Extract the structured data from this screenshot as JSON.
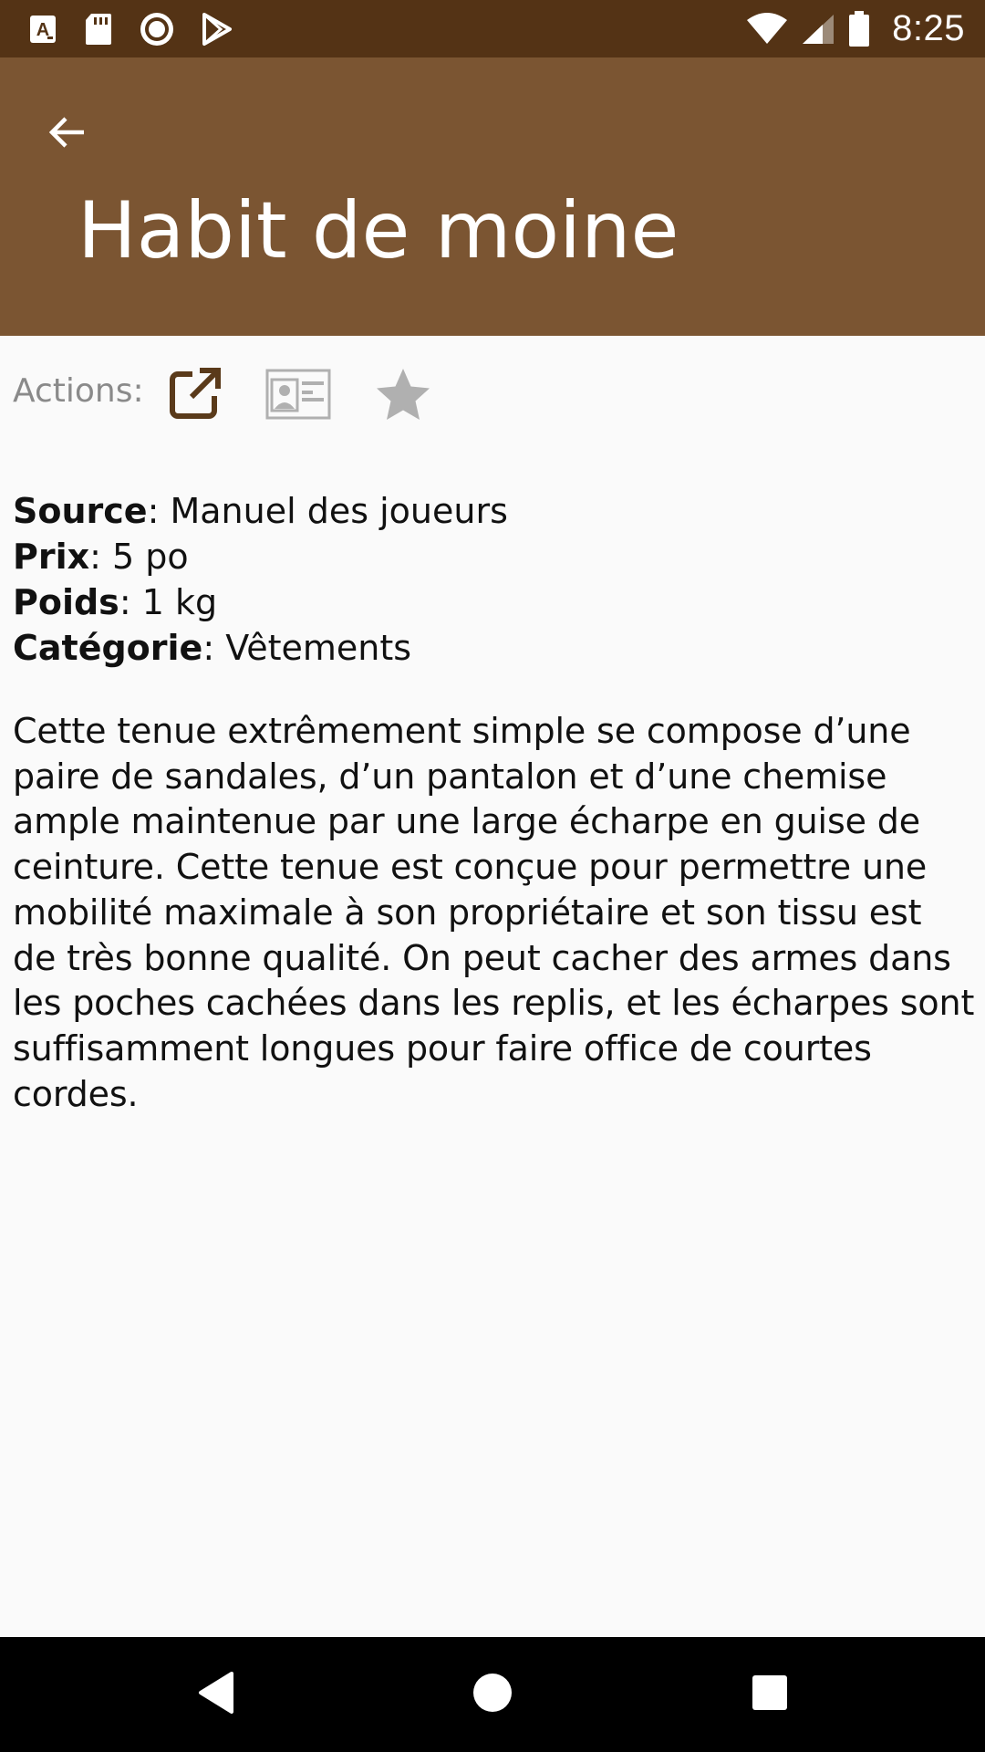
{
  "status_bar": {
    "time": "8:25",
    "icons": [
      "a-notification-icon",
      "sd-card-icon",
      "record-icon",
      "play-store-icon",
      "wifi-icon",
      "cell-signal-icon",
      "battery-icon"
    ]
  },
  "app_bar": {
    "back_icon": "arrow-back-icon",
    "title": "Habit de moine",
    "background": "#7B5532"
  },
  "actions": {
    "label": "Actions:",
    "buttons": [
      {
        "name": "open-external",
        "icon": "open-in-new-icon",
        "color": "#5A3A1A"
      },
      {
        "name": "character-sheet",
        "icon": "id-card-icon",
        "color": "#B0B0B0"
      },
      {
        "name": "favorite",
        "icon": "star-icon",
        "color": "#B0B0B0"
      }
    ]
  },
  "details": {
    "source": {
      "key": "Source",
      "value": ": Manuel des joueurs"
    },
    "price": {
      "key": "Prix",
      "value": ": 5 po"
    },
    "weight": {
      "key": "Poids",
      "value": ": 1 kg"
    },
    "category": {
      "key": "Catégorie",
      "value": ": Vêtements"
    }
  },
  "description": "Cette tenue extrêmement simple se compose d’une paire de sandales, d’un pantalon et d’une chemise ample maintenue par une large écharpe en guise de ceinture. Cette tenue est conçue pour permettre une mobilité maximale à son propriétaire et son tissu est de très bonne qualité. On peut cacher des armes dans les poches cachées dans les replis, et les écharpes sont suffisamment longues pour faire office de courtes cordes.",
  "nav_bar": {
    "buttons": [
      "back-triangle-icon",
      "home-circle-icon",
      "recents-square-icon"
    ]
  },
  "colors": {
    "status_bar": "#543315",
    "app_bar": "#7B5532",
    "background": "#FAFAFA",
    "nav_bar": "#000000"
  }
}
